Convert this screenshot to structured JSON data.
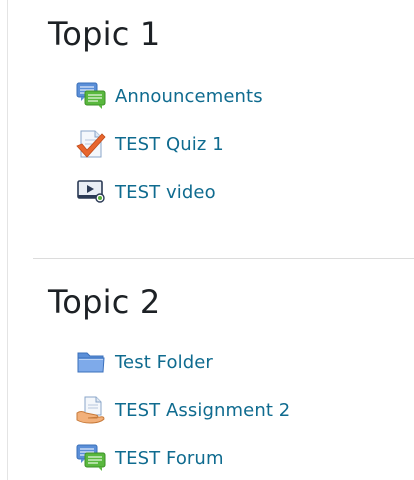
{
  "sections": [
    {
      "title": "Topic 1",
      "activities": [
        {
          "label": "Announcements",
          "icon": "forum-icon"
        },
        {
          "label": "TEST Quiz 1",
          "icon": "quiz-icon"
        },
        {
          "label": "TEST video",
          "icon": "video-icon"
        }
      ]
    },
    {
      "title": "Topic 2",
      "activities": [
        {
          "label": "Test Folder",
          "icon": "folder-icon"
        },
        {
          "label": "TEST Assignment 2",
          "icon": "assignment-icon"
        },
        {
          "label": "TEST Forum",
          "icon": "forum-icon"
        }
      ]
    }
  ],
  "colors": {
    "link": "#0f6b8f",
    "heading": "#1d2125",
    "divider": "#dcdcdc"
  }
}
